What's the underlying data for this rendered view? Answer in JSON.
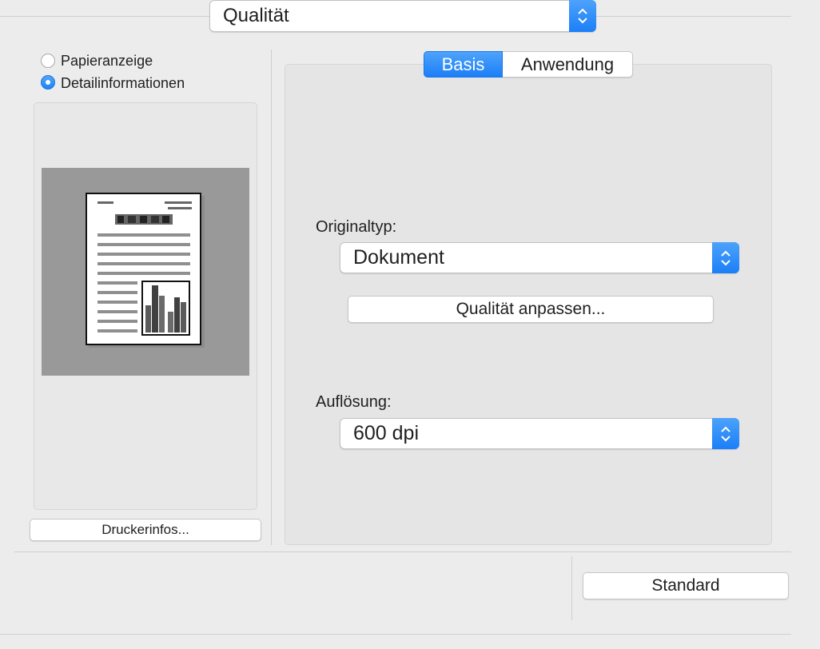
{
  "header": {
    "section_select_value": "Qualität"
  },
  "preview": {
    "radio_paper": "Papieranzeige",
    "radio_details": "Detailinformationen",
    "selected": "Detailinformationen",
    "printer_info_button": "Druckerinfos..."
  },
  "tabs": [
    {
      "label": "Basis",
      "active": true
    },
    {
      "label": "Anwendung",
      "active": false
    }
  ],
  "basis": {
    "original_type_label": "Originaltyp:",
    "original_type_value": "Dokument",
    "adjust_quality_button": "Qualität anpassen...",
    "resolution_label": "Auflösung:",
    "resolution_value": "600 dpi"
  },
  "footer": {
    "default_button": "Standard"
  },
  "colors": {
    "accent": "#1b7ff7",
    "panel": "#e5e5e5",
    "background": "#ececec"
  }
}
